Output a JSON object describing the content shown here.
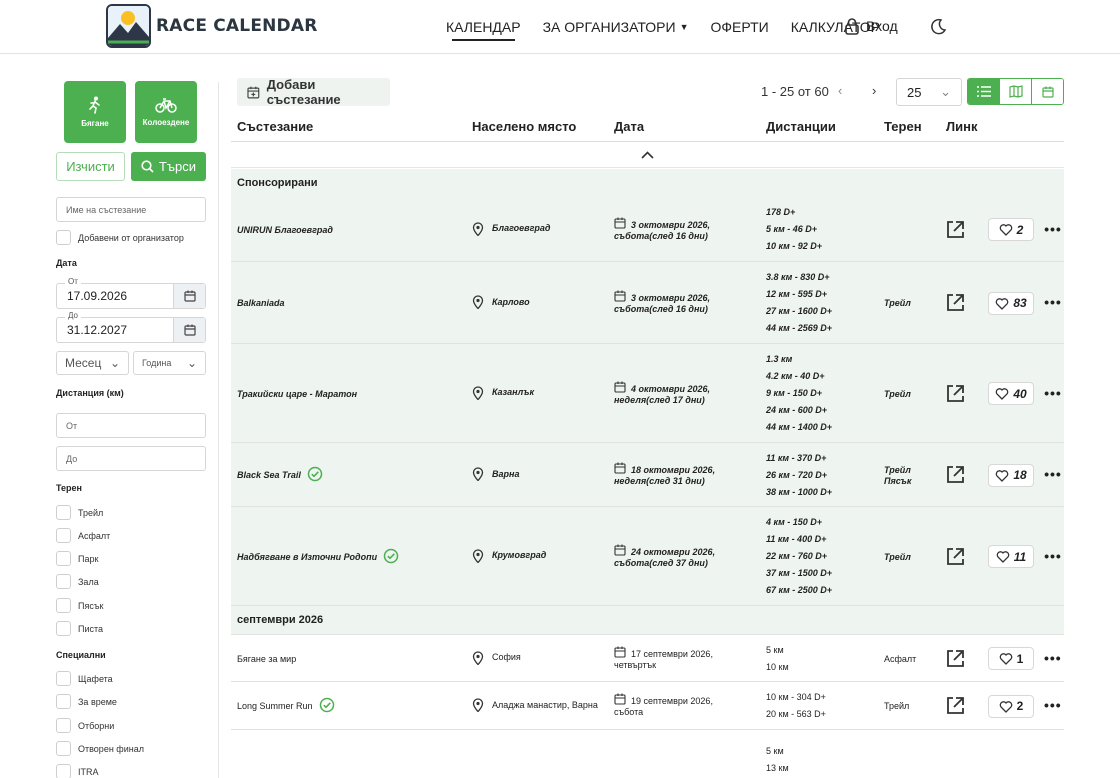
{
  "header": {
    "logo_text": "RACE CALENDAR",
    "nav": [
      {
        "label": "КАЛЕНДАР",
        "active": true
      },
      {
        "label": "ЗА ОРГАНИЗАТОРИ",
        "dropdown": true
      },
      {
        "label": "ОФЕРТИ"
      },
      {
        "label": "КАЛКУЛАТОР"
      }
    ],
    "login_label": "Вход"
  },
  "sidebar": {
    "sports": [
      {
        "label": "Бягане",
        "icon": "running-icon"
      },
      {
        "label": "Колоездене",
        "icon": "bicycle-icon"
      }
    ],
    "clear_label": "Изчисти",
    "search_label": "Търси",
    "name_placeholder": "Име на състезание",
    "organizer_label": "Добавени от организатор",
    "date_label": "Дата",
    "from_label": "От",
    "to_label": "До",
    "date_from": "17.09.2026",
    "date_to": "31.12.2027",
    "month_label": "Месец",
    "year_label": "Година",
    "distance_label": "Дистанция (км)",
    "dist_from_placeholder": "От",
    "dist_to_placeholder": "До",
    "terrain_label": "Терен",
    "terrains": [
      "Трейл",
      "Асфалт",
      "Парк",
      "Зала",
      "Пясък",
      "Писта"
    ],
    "special_label": "Специални",
    "specials": [
      "Щафета",
      "За време",
      "Отборни",
      "Отворен финал",
      "ITRA"
    ]
  },
  "toolbar": {
    "add_label": "Добави състезание",
    "pager_text": "1 - 25 от 60",
    "prev": "‹",
    "next": "›",
    "per_page": "25"
  },
  "table": {
    "headers": {
      "name": "Състезание",
      "place": "Населено място",
      "date": "Дата",
      "distances": "Дистанции",
      "terrain": "Терен",
      "link": "Линк"
    },
    "groups": [
      {
        "title": "Спонсорирани",
        "sponsored": true,
        "rows": [
          {
            "name": "UNIRUN Благоевград",
            "verified": false,
            "place": "Благоевград",
            "date": "3 октомври 2026, събота(след 16 дни)",
            "distances": [
              "178 D+",
              "5 км - 46 D+",
              "10 км - 92 D+"
            ],
            "terrain": [],
            "likes": "2"
          },
          {
            "name": "Balkaniada",
            "verified": false,
            "place": "Карлово",
            "date": "3 октомври 2026, събота(след 16 дни)",
            "distances": [
              "3.8 км - 830 D+",
              "12 км - 595 D+",
              "27 км - 1600 D+",
              "44 км - 2569 D+"
            ],
            "terrain": [
              "Трейл"
            ],
            "likes": "83"
          },
          {
            "name": "Тракийски царе - Маратон",
            "verified": false,
            "place": "Казанлък",
            "date": "4 октомври 2026, неделя(след 17 дни)",
            "distances": [
              "1.3 км",
              "4.2 км - 40 D+",
              "9 км - 150 D+",
              "24 км - 600 D+",
              "44 км - 1400 D+"
            ],
            "terrain": [
              "Трейл"
            ],
            "likes": "40"
          },
          {
            "name": "Black Sea Trail",
            "verified": true,
            "place": "Варна",
            "date": "18 октомври 2026, неделя(след 31 дни)",
            "distances": [
              "11 км - 370 D+",
              "26 км - 720 D+",
              "38 км - 1000 D+"
            ],
            "terrain": [
              "Трейл",
              "Пясък"
            ],
            "likes": "18"
          },
          {
            "name": "Надбягване в Източни Родопи",
            "verified": true,
            "place": "Крумовград",
            "date": "24 октомври 2026, събота(след 37 дни)",
            "distances": [
              "4 км - 150 D+",
              "11 км - 400 D+",
              "22 км - 760 D+",
              "37 км - 1500 D+",
              "67 км - 2500 D+"
            ],
            "terrain": [
              "Трейл"
            ],
            "likes": "11"
          }
        ]
      },
      {
        "title": "септември 2026",
        "sponsored": false,
        "rows": [
          {
            "name": "Бягане за мир",
            "verified": false,
            "place": "София",
            "date": "17 септември 2026, четвъртък",
            "distances": [
              "5 км",
              "10 км"
            ],
            "terrain": [
              "Асфалт"
            ],
            "likes": "1"
          },
          {
            "name": "Long Summer Run",
            "verified": true,
            "place": "Аладжа манастир, Варна",
            "date": "19 септември 2026, събота",
            "distances": [
              "10 км - 304 D+",
              "20 км - 563 D+"
            ],
            "terrain": [
              "Трейл"
            ],
            "likes": "2"
          },
          {
            "name": "",
            "verified": false,
            "place": "",
            "date": "",
            "distances": [
              "5 км",
              "13 км"
            ],
            "terrain": [],
            "likes": ""
          }
        ]
      }
    ]
  },
  "colors": {
    "accent": "#4caf50",
    "sponsored_bg": "#eef4ef"
  }
}
